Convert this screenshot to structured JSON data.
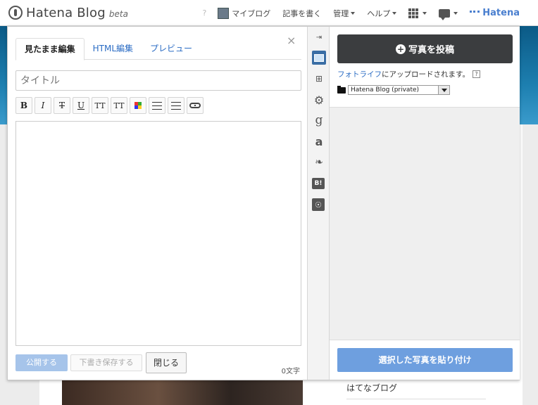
{
  "global_header": {
    "logo_text": "Hatena Blog",
    "logo_beta": "beta",
    "help_mark": "?",
    "nav": {
      "my_blog": "マイブログ",
      "write": "記事を書く",
      "manage": "管理",
      "help": "ヘルプ",
      "brand": "Hatena"
    }
  },
  "editor": {
    "tabs": [
      "見たまま編集",
      "HTML編集",
      "プレビュー"
    ],
    "close_symbol": "×",
    "title_placeholder": "タイトル",
    "toolbar": {
      "bold": "B",
      "italic": "I",
      "strike": "T",
      "underline": "U",
      "font_size_up": "TT",
      "font_size_down": "TT"
    },
    "buttons": {
      "publish": "公開する",
      "save_draft": "下書き保存する",
      "close": "閉じる"
    },
    "char_count": "0文字"
  },
  "side_icons": [
    "collapse-icon",
    "photo-icon",
    "folder-tree-icon",
    "gear-icon",
    "google-icon",
    "amazon-icon",
    "twitter-icon",
    "hatena-bookmark-icon",
    "robot-icon"
  ],
  "photo_panel": {
    "upload_button": "写真を投稿",
    "upload_note_link": "フォトライフ",
    "upload_note_text": "にアップロードされます。",
    "help": "?",
    "album_selected": "Hatena Blog (private)",
    "paste_button": "選択した写真を貼り付け"
  },
  "background_page": {
    "sidebar_link": "はてなブログ"
  },
  "colors": {
    "accent_blue": "#2b6cc4",
    "paste_button": "#6e9fdf",
    "upload_button": "#3b3d3f",
    "banner": "#1d7fb0"
  }
}
